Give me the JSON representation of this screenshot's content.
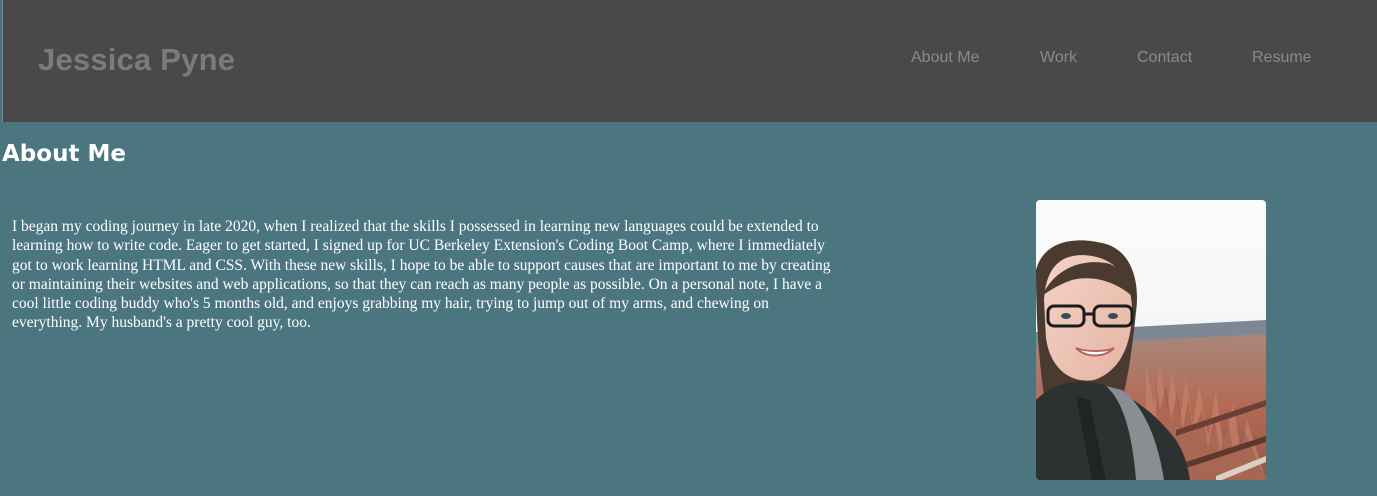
{
  "header": {
    "brand": "Jessica Pyne",
    "nav": [
      {
        "label": "About Me"
      },
      {
        "label": "Work"
      },
      {
        "label": "Contact"
      },
      {
        "label": "Resume"
      }
    ]
  },
  "about": {
    "title": "About Me",
    "bio": "I began my coding journey in late 2020, when I realized that the skills I possessed in learning new languages could be extended to learning how to write code. Eager to get started, I signed up for UC Berkeley Extension's Coding Boot Camp, where I immediately got to work learning HTML and CSS. With these new skills, I hope to be able to support causes that are important to me by creating or maintaining their websites and web applications, so that they can reach as many people as possible. On a personal note, I have a cool little coding buddy who's 5 months old, and enjoys grabbing my hair, trying to jump out of my arms, and chewing on everything. My husband's a pretty cool guy, too."
  },
  "colors": {
    "page_background": "#4b7680",
    "header_background": "#494949",
    "brand_text": "#7b7b7b",
    "nav_text": "#8a8a8a",
    "body_text": "#ffffff"
  }
}
